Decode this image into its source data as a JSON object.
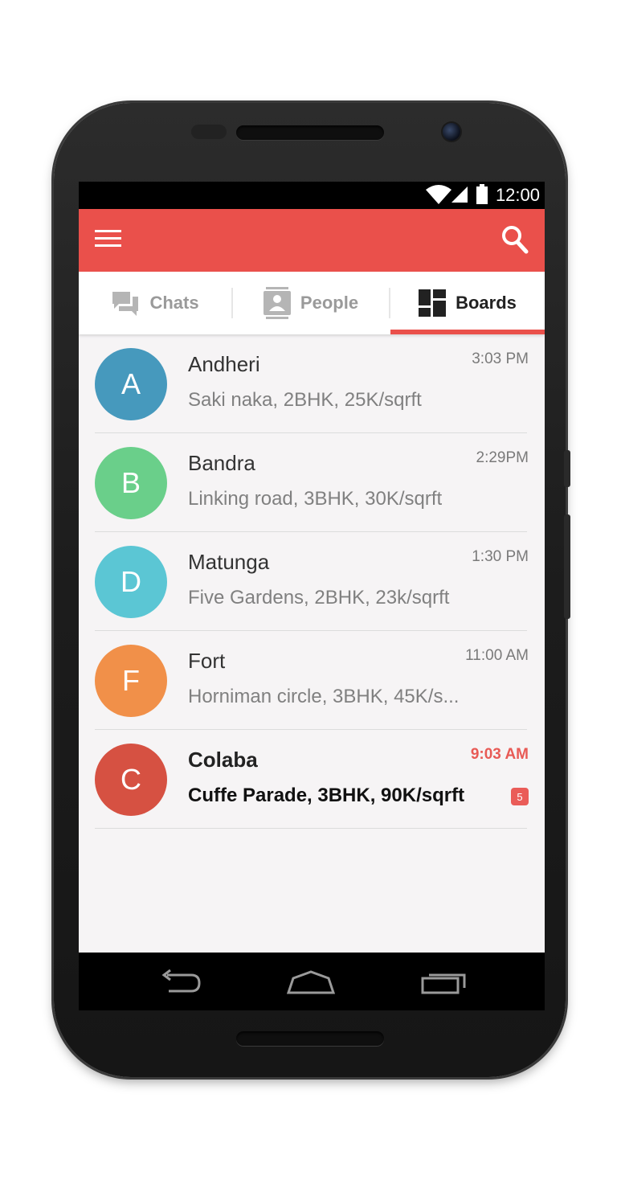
{
  "status_bar": {
    "time": "12:00"
  },
  "app_bar": {
    "menu_icon": "menu-icon",
    "search_icon": "search-icon",
    "color": "#ea504b"
  },
  "tabs": [
    {
      "label": "Chats",
      "icon": "chat-icon",
      "active": false
    },
    {
      "label": "People",
      "icon": "contact-icon",
      "active": false
    },
    {
      "label": "Boards",
      "icon": "dashboard-icon",
      "active": true
    }
  ],
  "boards": [
    {
      "initial": "A",
      "title": "Andheri",
      "subtitle": "Saki naka, 2BHK, 25K/sqrft",
      "time": "3:03 PM",
      "color": "#4699bd",
      "unread": false
    },
    {
      "initial": "B",
      "title": "Bandra",
      "subtitle": "Linking road, 3BHK, 30K/sqrft",
      "time": "2:29PM",
      "color": "#6acf8a",
      "unread": false
    },
    {
      "initial": "D",
      "title": "Matunga",
      "subtitle": "Five Gardens, 2BHK, 23k/sqrft",
      "time": "1:30 PM",
      "color": "#5bc6d4",
      "unread": false
    },
    {
      "initial": "F",
      "title": "Fort",
      "subtitle": "Horniman circle, 3BHK, 45K/s...",
      "time": "11:00 AM",
      "color": "#f19049",
      "unread": false
    },
    {
      "initial": "C",
      "title": "Colaba",
      "subtitle": "Cuffe Parade, 3BHK, 90K/sqrft",
      "time": "9:03 AM",
      "color": "#d65142",
      "unread": true,
      "badge": "5"
    }
  ],
  "fab": {
    "icon": "plus-icon",
    "color": "#ee5b5a"
  },
  "nav_bar": {
    "back_icon": "back-icon",
    "home_icon": "home-icon",
    "recents_icon": "recents-icon"
  }
}
